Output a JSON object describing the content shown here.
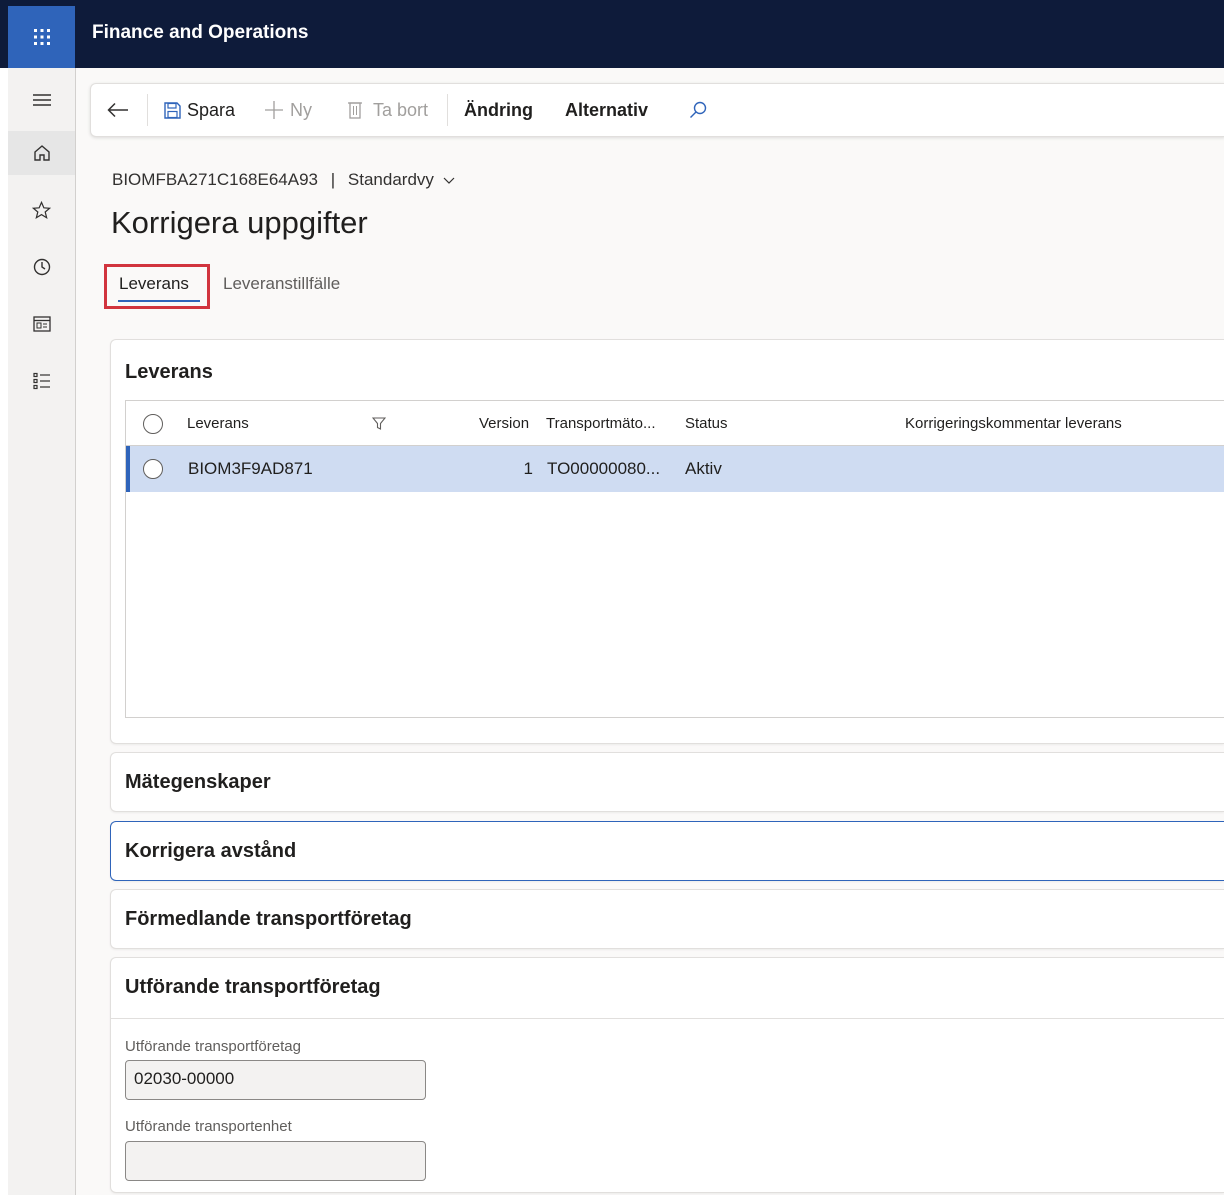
{
  "app": {
    "title": "Finance and Operations"
  },
  "toolbar": {
    "save_label": "Spara",
    "new_label": "Ny",
    "delete_label": "Ta bort",
    "change_label": "Ändring",
    "options_label": "Alternativ"
  },
  "breadcrumb": {
    "record": "BIOMFBA271C168E64A93",
    "separator": "|",
    "view": "Standardvy"
  },
  "page": {
    "title": "Korrigera uppgifter"
  },
  "tabs": [
    {
      "label": "Leverans",
      "selected": true
    },
    {
      "label": "Leveranstillfälle",
      "selected": false
    }
  ],
  "sections": {
    "leverans": {
      "title": "Leverans",
      "columns": [
        "Leverans",
        "Version",
        "Transportmäto...",
        "Status",
        "Korrigeringskommentar leverans"
      ],
      "rows": [
        {
          "leverans": "BIOM3F9AD871",
          "version": "1",
          "transport": "TO00000080...",
          "status": "Aktiv",
          "comment": ""
        }
      ]
    },
    "metegenskaper": {
      "title": "Mätegenskaper"
    },
    "korrigera_avstand": {
      "title": "Korrigera avstånd"
    },
    "formedlande": {
      "title": "Förmedlande transportföretag"
    },
    "utforande": {
      "title": "Utförande transportföretag",
      "company_label": "Utförande transportföretag",
      "company_value": "02030-00000",
      "unit_label": "Utförande transportenhet",
      "unit_value": ""
    }
  },
  "colors": {
    "header_bg": "#0e1b3a",
    "waffle_bg": "#2f64ba",
    "accent": "#2f64ba",
    "selected_row": "#cfdcf2",
    "highlight_box": "#d1343e"
  }
}
